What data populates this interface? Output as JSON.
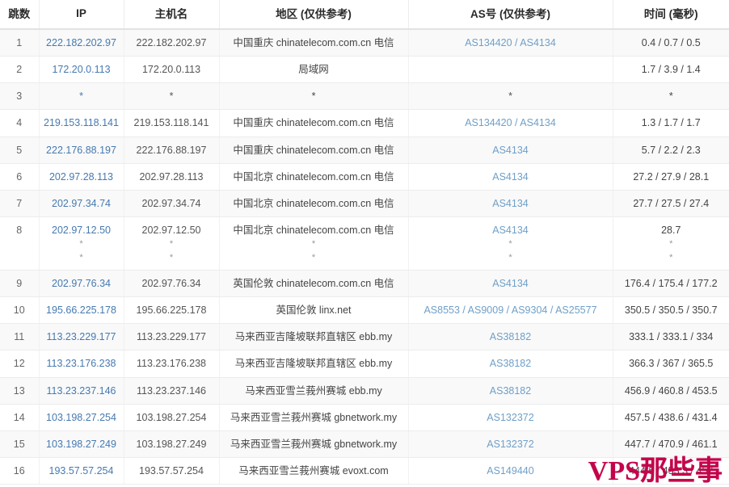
{
  "table": {
    "headers": {
      "hop": "跳数",
      "ip": "IP",
      "host": "主机名",
      "geo": "地区 (仅供参考)",
      "as": "AS号 (仅供参考)",
      "time": "时间 (毫秒)"
    },
    "rows": [
      {
        "hop": "1",
        "ip": "222.182.202.97",
        "host": "222.182.202.97",
        "geo": "中国重庆 chinatelecom.com.cn 电信",
        "as": "AS134420 / AS4134",
        "time": "0.4 / 0.7 / 0.5",
        "extra": []
      },
      {
        "hop": "2",
        "ip": "172.20.0.113",
        "host": "172.20.0.113",
        "geo": "局域网",
        "as": "",
        "time": "1.7 / 3.9 / 1.4",
        "extra": []
      },
      {
        "hop": "3",
        "ip": "*",
        "host": "*",
        "geo": "*",
        "as": "*",
        "time": "*",
        "extra": []
      },
      {
        "hop": "4",
        "ip": "219.153.118.141",
        "host": "219.153.118.141",
        "geo": "中国重庆 chinatelecom.com.cn 电信",
        "as": "AS134420 / AS4134",
        "time": "1.3 / 1.7 / 1.7",
        "extra": []
      },
      {
        "hop": "5",
        "ip": "222.176.88.197",
        "host": "222.176.88.197",
        "geo": "中国重庆 chinatelecom.com.cn 电信",
        "as": "AS4134",
        "time": "5.7 / 2.2 / 2.3",
        "extra": []
      },
      {
        "hop": "6",
        "ip": "202.97.28.113",
        "host": "202.97.28.113",
        "geo": "中国北京 chinatelecom.com.cn 电信",
        "as": "AS4134",
        "time": "27.2 / 27.9 / 28.1",
        "extra": []
      },
      {
        "hop": "7",
        "ip": "202.97.34.74",
        "host": "202.97.34.74",
        "geo": "中国北京 chinatelecom.com.cn 电信",
        "as": "AS4134",
        "time": "27.7 / 27.5 / 27.4",
        "extra": []
      },
      {
        "hop": "8",
        "ip": "202.97.12.50",
        "host": "202.97.12.50",
        "geo": "中国北京 chinatelecom.com.cn 电信",
        "as": "AS4134",
        "time": "28.7",
        "extra": [
          "*",
          "*"
        ]
      },
      {
        "hop": "9",
        "ip": "202.97.76.34",
        "host": "202.97.76.34",
        "geo": "英国伦敦 chinatelecom.com.cn 电信",
        "as": "AS4134",
        "time": "176.4 / 175.4 / 177.2",
        "extra": []
      },
      {
        "hop": "10",
        "ip": "195.66.225.178",
        "host": "195.66.225.178",
        "geo": "英国伦敦 linx.net",
        "as": "AS8553 / AS9009 / AS9304 / AS25577",
        "time": "350.5 / 350.5 / 350.7",
        "extra": []
      },
      {
        "hop": "11",
        "ip": "113.23.229.177",
        "host": "113.23.229.177",
        "geo": "马来西亚吉隆坡联邦直辖区 ebb.my",
        "as": "AS38182",
        "time": "333.1 / 333.1 / 334",
        "extra": []
      },
      {
        "hop": "12",
        "ip": "113.23.176.238",
        "host": "113.23.176.238",
        "geo": "马来西亚吉隆坡联邦直辖区 ebb.my",
        "as": "AS38182",
        "time": "366.3 / 367 / 365.5",
        "extra": []
      },
      {
        "hop": "13",
        "ip": "113.23.237.146",
        "host": "113.23.237.146",
        "geo": "马来西亚雪兰莪州赛城 ebb.my",
        "as": "AS38182",
        "time": "456.9 / 460.8 / 453.5",
        "extra": []
      },
      {
        "hop": "14",
        "ip": "103.198.27.254",
        "host": "103.198.27.254",
        "geo": "马来西亚雪兰莪州赛城 gbnetwork.my",
        "as": "AS132372",
        "time": "457.5 / 438.6 / 431.4",
        "extra": []
      },
      {
        "hop": "15",
        "ip": "103.198.27.249",
        "host": "103.198.27.249",
        "geo": "马来西亚雪兰莪州赛城 gbnetwork.my",
        "as": "AS132372",
        "time": "447.7 / 470.9 / 461.1",
        "extra": []
      },
      {
        "hop": "16",
        "ip": "193.57.57.254",
        "host": "193.57.57.254",
        "geo": "马来西亚雪兰莪州赛城 evoxt.com",
        "as": "AS149440",
        "time": "444.5 / 453.3 / 457",
        "extra": []
      }
    ]
  },
  "watermark": {
    "text": "VPS那些事",
    "color": "#c3044b"
  },
  "colors": {
    "ip_link": "#4679b0",
    "as_link": "#6f9fc8",
    "row_odd": "#f9f9f9",
    "row_even": "#ffffff",
    "header_text": "#2a2a2a"
  }
}
